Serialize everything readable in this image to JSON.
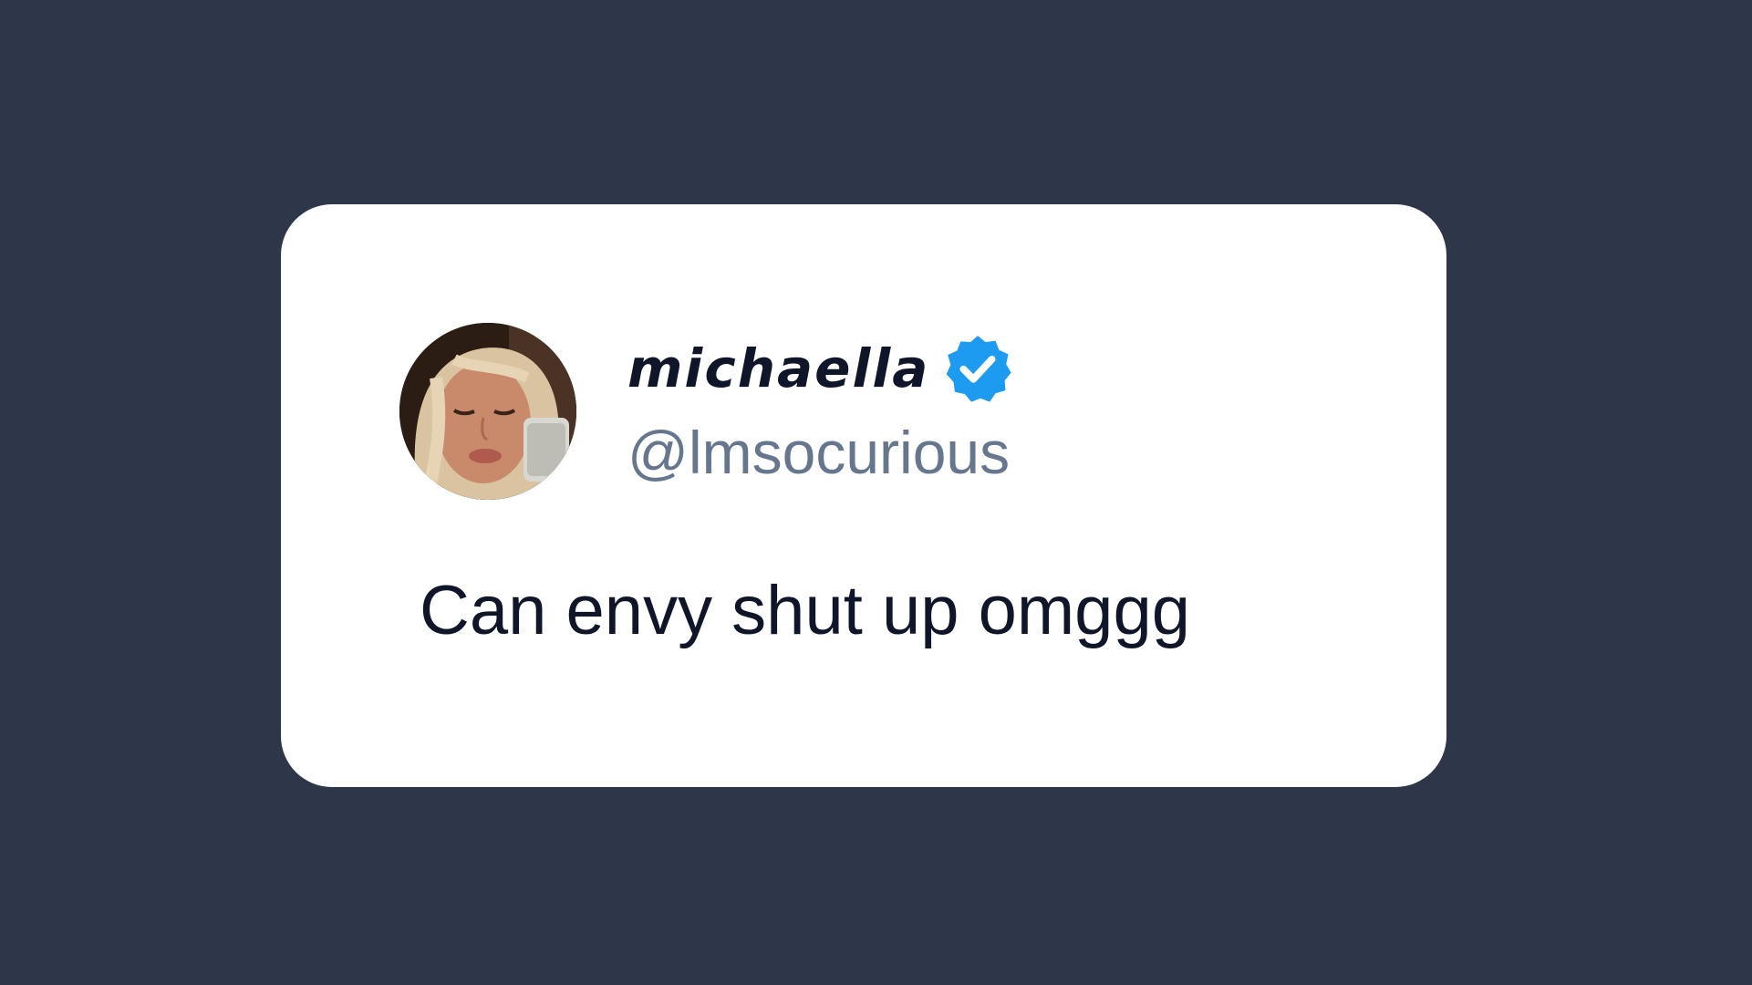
{
  "tweet": {
    "display_name": "michaella",
    "handle": "@lmsocurious",
    "text": "Can envy shut up omggg",
    "verified": true,
    "avatar": "profile-photo",
    "badge_icon": "verified-check-icon"
  },
  "colors": {
    "background": "#2e3649",
    "card": "#ffffff",
    "name_text": "#0f1629",
    "handle_text": "#66768f",
    "body_text": "#0f1629",
    "verified_blue": "#1d9bf0"
  }
}
